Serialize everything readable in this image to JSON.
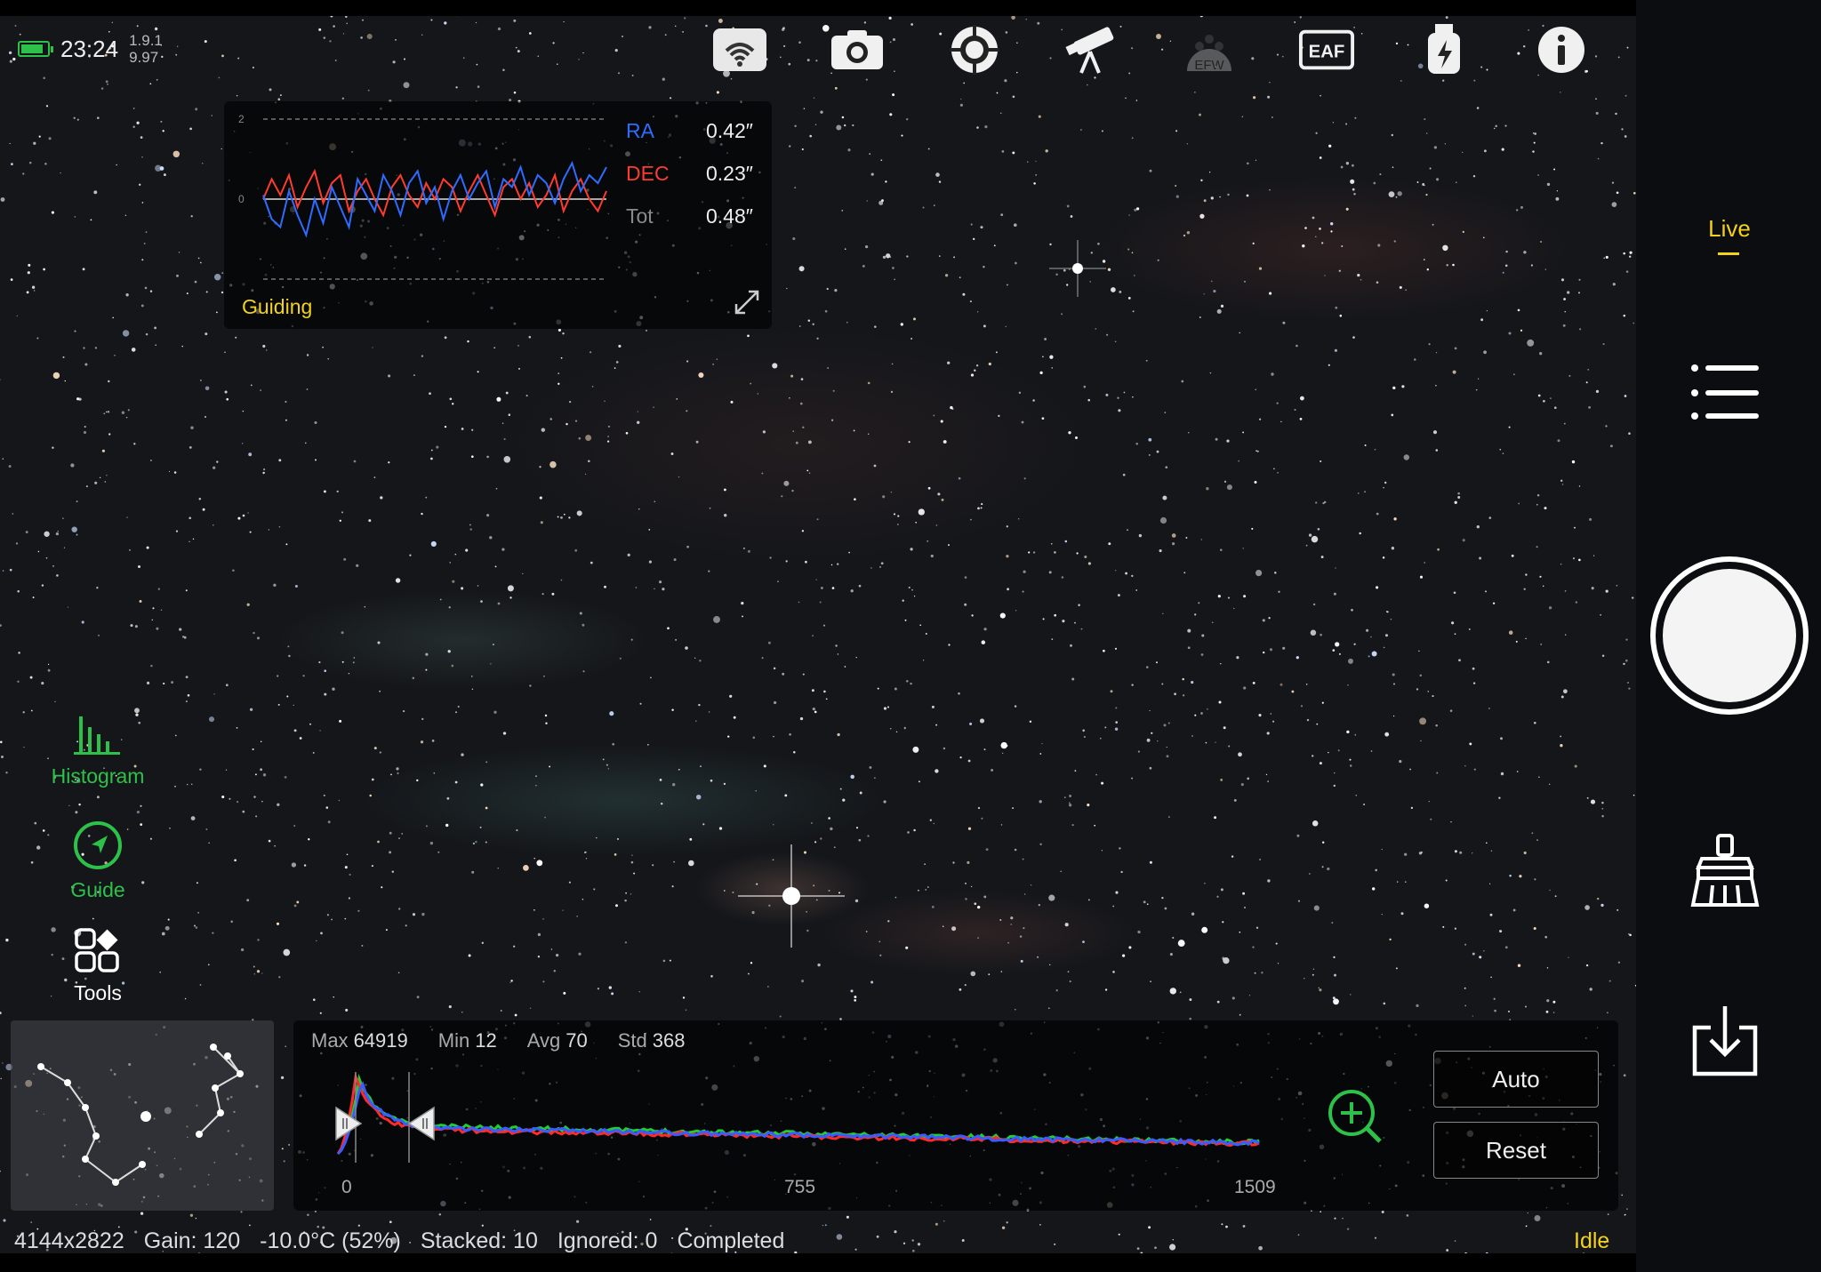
{
  "status": {
    "time": "23:24",
    "version_top": "1.9.1",
    "version_bottom": "9.97",
    "battery_level": 0.85,
    "battery_color": "#2ec14a"
  },
  "toolbar": {
    "icons": [
      "wifi-icon",
      "camera-icon",
      "guider-icon",
      "telescope-icon",
      "efw-icon",
      "eaf-icon",
      "usb-power-icon",
      "info-icon"
    ],
    "efw_label": "EFW",
    "eaf_label": "EAF"
  },
  "guiding": {
    "title": "Guiding",
    "axis_top": "2",
    "axis_mid": "0",
    "stats": [
      {
        "label": "RA",
        "value": "0.42″",
        "color": "#2f6bff"
      },
      {
        "label": "DEC",
        "value": "0.23″",
        "color": "#ff3b2f"
      },
      {
        "label": "Tot",
        "value": "0.48″",
        "color": "#8a8a8a"
      }
    ],
    "ra_series": [
      0.1,
      -0.5,
      -0.7,
      0.2,
      -0.4,
      -0.9,
      0.0,
      -0.6,
      0.3,
      -0.2,
      -0.7,
      0.5,
      0.1,
      -0.3,
      0.6,
      0.2,
      -0.4,
      0.4,
      0.7,
      -0.1,
      0.3,
      -0.5,
      0.2,
      0.6,
      0.0,
      0.4,
      0.7,
      -0.2,
      0.5,
      0.3,
      0.8,
      0.1,
      0.6,
      0.4,
      -0.1,
      0.5,
      0.9,
      0.2,
      0.6,
      0.4,
      0.8
    ],
    "dec_series": [
      0.0,
      0.5,
      0.1,
      0.6,
      -0.2,
      0.3,
      0.7,
      -0.1,
      0.4,
      0.6,
      -0.3,
      0.2,
      0.5,
      0.0,
      -0.4,
      0.3,
      0.6,
      0.1,
      -0.2,
      0.4,
      0.0,
      0.5,
      0.3,
      -0.3,
      0.2,
      0.6,
      0.1,
      -0.4,
      0.3,
      0.5,
      0.0,
      0.4,
      -0.2,
      0.1,
      0.6,
      -0.3,
      0.2,
      0.5,
      0.0,
      -0.3,
      0.2
    ]
  },
  "left_tools": [
    {
      "label": "Histogram",
      "icon": "histogram-icon",
      "color": "#2ec14a"
    },
    {
      "label": "Guide",
      "icon": "guide-icon",
      "color": "#2ec14a"
    },
    {
      "label": "Tools",
      "icon": "tools-icon",
      "color": "#ffffff"
    }
  ],
  "histogram": {
    "max_label": "Max",
    "max_value": "64919",
    "min_label": "Min",
    "min_value": "12",
    "avg_label": "Avg",
    "avg_value": "70",
    "std_label": "Std",
    "std_value": "368",
    "axis_ticks": [
      "0",
      "755",
      "1509"
    ],
    "auto_button": "Auto",
    "reset_button": "Reset",
    "black_point": 30,
    "white_point": 110
  },
  "statusline": {
    "resolution": "4144x2822",
    "gain": "Gain: 120",
    "temperature": "-10.0°C (52%)",
    "stacked": "Stacked: 10",
    "ignored": "Ignored: 0",
    "state": "Completed",
    "mode": "Idle"
  },
  "sidebar": {
    "live_label": "Live",
    "icons": [
      "menu-list-icon",
      "shutter-button",
      "clean-brush-icon",
      "download-icon"
    ]
  }
}
